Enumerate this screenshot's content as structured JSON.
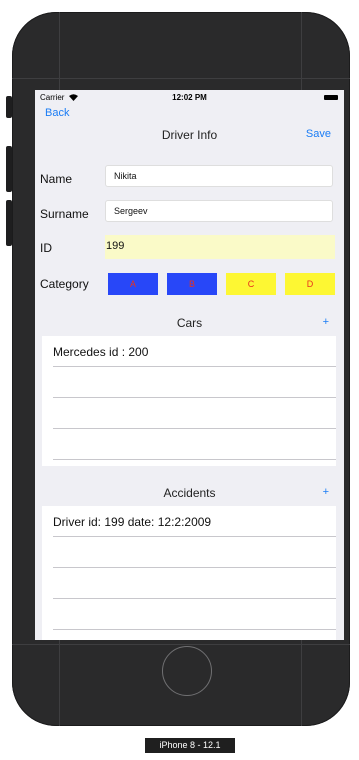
{
  "status_bar": {
    "carrier": "Carrier",
    "time": "12:02 PM"
  },
  "nav": {
    "back": "Back",
    "title": "Driver Info",
    "save": "Save"
  },
  "form": {
    "name_label": "Name",
    "name_value": "Nikita",
    "surname_label": "Surname",
    "surname_value": "Sergeev",
    "id_label": "ID",
    "id_value": "199",
    "category_label": "Category"
  },
  "categories": [
    {
      "label": "A",
      "color": "#2847f8"
    },
    {
      "label": "B",
      "color": "#2847f8"
    },
    {
      "label": "C",
      "color": "#fdf733"
    },
    {
      "label": "D",
      "color": "#fdf733"
    }
  ],
  "cars": {
    "title": "Cars",
    "add": "+",
    "rows": [
      "Mercedes id : 200"
    ]
  },
  "accidents": {
    "title": "Accidents",
    "add": "+",
    "rows": [
      "Driver id: 199 date: 12:2:2009"
    ]
  },
  "device_caption": "iPhone 8 - 12.1",
  "colors": {
    "accent": "#1a7cf5",
    "id_bg": "#fafac8",
    "background": "#efeff4",
    "frame": "#2a2a2b"
  }
}
